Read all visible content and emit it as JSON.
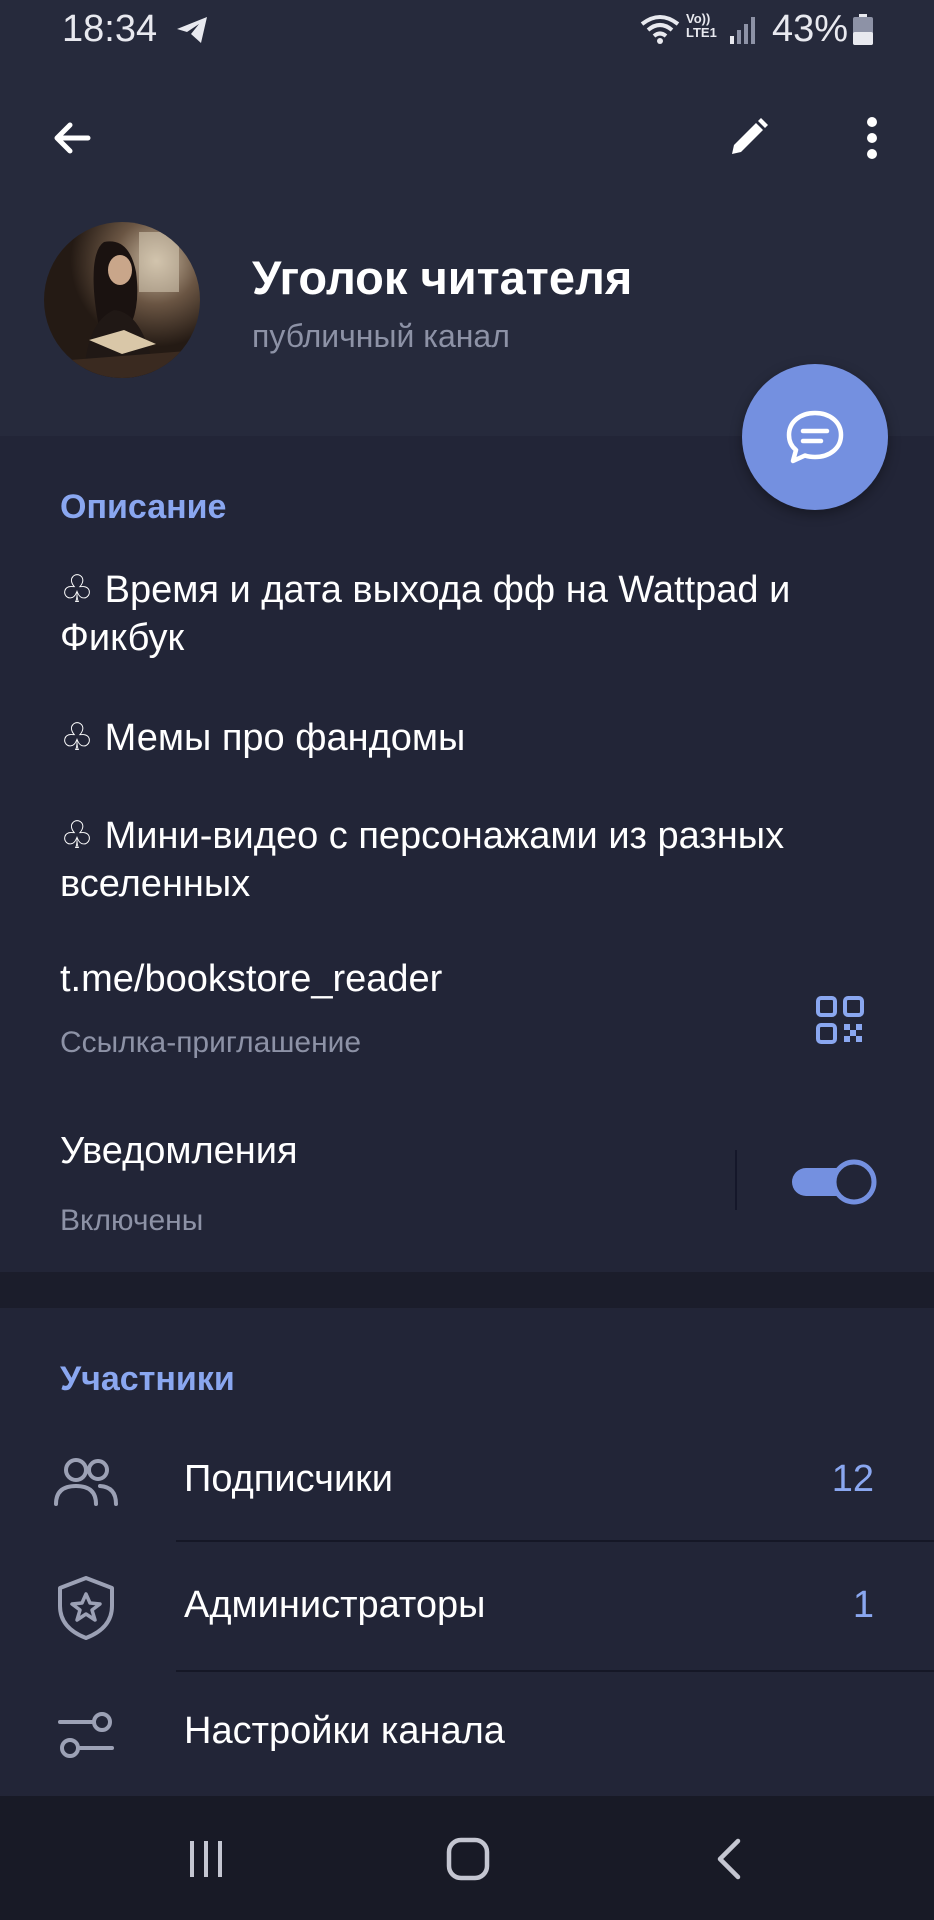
{
  "status_bar": {
    "time": "18:34",
    "volte_line1": "Vo))",
    "volte_line2": "LTE1",
    "battery": "43%"
  },
  "header": {
    "title": "Уголок читателя",
    "subtitle": "публичный канал"
  },
  "description": {
    "header": "Описание",
    "lines": [
      "♧ Время и дата выхода фф на Wattpad и Фикбук",
      "♧ Мемы про фандомы",
      "♧ Мини-видео с персонажами из разных вселенных"
    ]
  },
  "link": {
    "url": "t.me/bookstore_reader",
    "caption": "Ссылка-приглашение"
  },
  "notifications": {
    "label": "Уведомления",
    "caption": "Включены",
    "enabled": true
  },
  "members": {
    "header": "Участники",
    "rows": [
      {
        "label": "Подписчики",
        "count": "12",
        "icon": "people-icon"
      },
      {
        "label": "Администраторы",
        "count": "1",
        "icon": "admin-shield-icon"
      },
      {
        "label": "Настройки канала",
        "count": "",
        "icon": "settings-sliders-icon"
      }
    ]
  },
  "colors": {
    "accent": "#8aa7f0",
    "fab": "#7490e0",
    "background": "#222537",
    "header_bg": "#262a3c"
  }
}
